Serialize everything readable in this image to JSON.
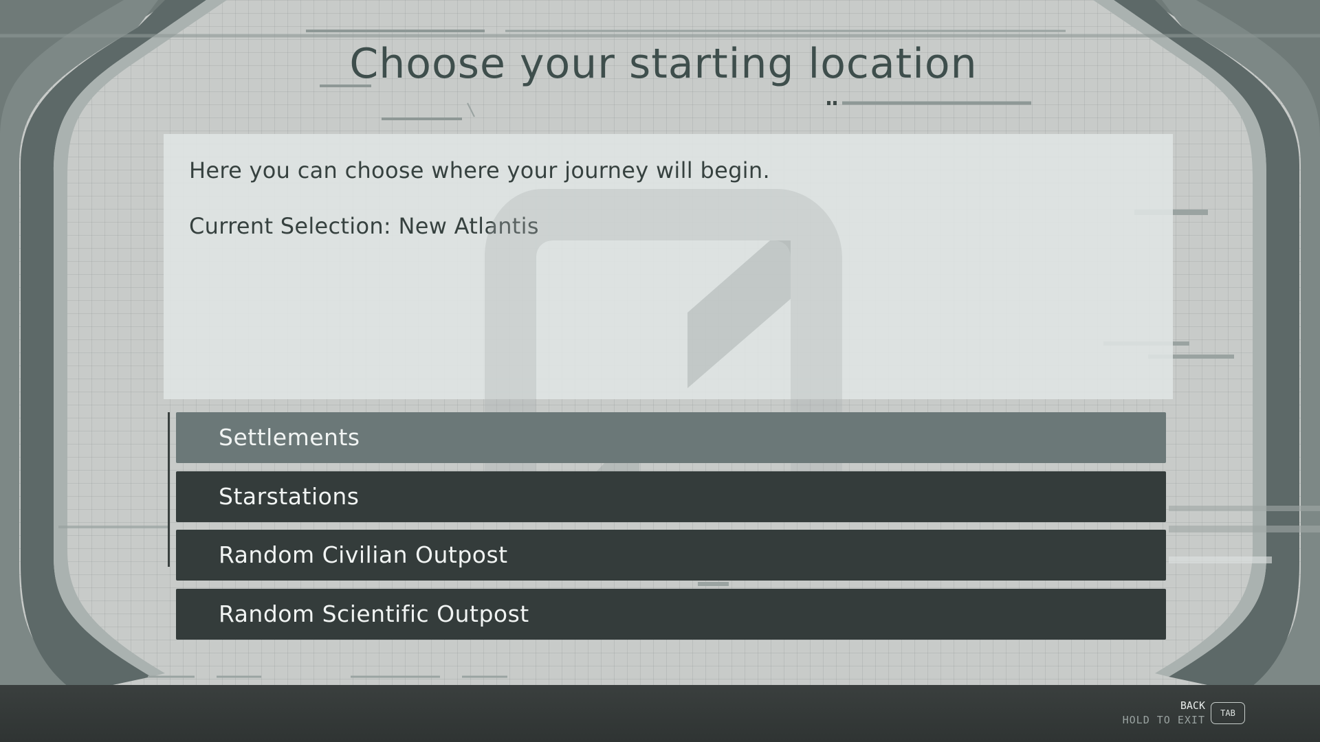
{
  "screen": {
    "title": "Choose your starting location"
  },
  "info": {
    "intro": "Here you can choose where your journey will begin.",
    "current_selection": "Current Selection: New Atlantis"
  },
  "menu": {
    "items": [
      {
        "label": "Settlements",
        "selected": true
      },
      {
        "label": "Starstations",
        "selected": false
      },
      {
        "label": "Random Civilian Outpost",
        "selected": false
      },
      {
        "label": "Random Scientific Outpost",
        "selected": false
      }
    ]
  },
  "hints": {
    "back_label": "BACK",
    "hold_label": "HOLD TO EXIT",
    "key_label": "TAB"
  },
  "colors": {
    "title": "#3e4e4c",
    "menu_selected": "#6b7878",
    "menu_default": "#343c3b",
    "menu_text": "#f1f4f3"
  },
  "icons": {
    "watermark": "constellation-logo-watermark"
  }
}
